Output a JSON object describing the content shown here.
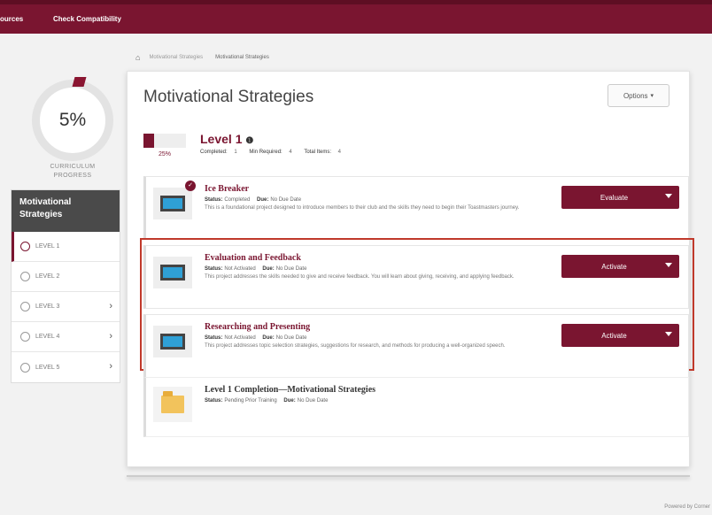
{
  "topbar": {
    "left_cut_link": "ources",
    "check_compat_link": "Check Compatibility"
  },
  "curriculum": {
    "percent": "5%",
    "label_line1": "CURRICULUM",
    "label_line2": "PROGRESS"
  },
  "side_nav": {
    "header": "Motivational Strategies",
    "levels": [
      {
        "label": "LEVEL 1",
        "has_chevron": false
      },
      {
        "label": "LEVEL 2",
        "has_chevron": false
      },
      {
        "label": "LEVEL 3",
        "has_chevron": true
      },
      {
        "label": "LEVEL 4",
        "has_chevron": true
      },
      {
        "label": "LEVEL 5",
        "has_chevron": true
      }
    ],
    "chevron": "›"
  },
  "breadcrumb": {
    "home_icon": "⌂",
    "items": [
      "Motivational Strategies",
      "Motivational Strategies"
    ]
  },
  "page": {
    "title": "Motivational Strategies",
    "options_label": "Options",
    "options_caret": "▾"
  },
  "level": {
    "title": "Level 1",
    "info_icon": "❶",
    "percent": "25%",
    "progress_fraction": 0.25,
    "completed_label": "Completed:",
    "completed_value": "1",
    "min_required_label": "Min Required:",
    "min_required_value": "4",
    "total_items_label": "Total Items:",
    "total_items_value": "4"
  },
  "projects": [
    {
      "title": "Ice Breaker",
      "status_label": "Status:",
      "status": "Completed",
      "due_label": "Due:",
      "due": "No Due Date",
      "desc": "This is a foundational project designed to introduce members to their club and the skills they need to begin their Toastmasters journey.",
      "action": "Evaluate",
      "completed_mark": "✓"
    },
    {
      "title": "Evaluation and Feedback",
      "status_label": "Status:",
      "status": "Not Activated",
      "due_label": "Due:",
      "due": "No Due Date",
      "desc": "This project addresses the skills needed to give and receive feedback. You will learn about giving, receiving, and applying feedback.",
      "action": "Activate"
    },
    {
      "title": "Researching and Presenting",
      "status_label": "Status:",
      "status": "Not Activated",
      "due_label": "Due:",
      "due": "No Due Date",
      "desc": "This project addresses topic selection strategies, suggestions for research, and methods for producing a well-organized speech.",
      "action": "Activate"
    }
  ],
  "completion": {
    "title": "Level 1 Completion—Motivational Strategies",
    "status_label": "Status:",
    "status": "Pending Prior Training",
    "due_label": "Due:",
    "due": "No Due Date"
  },
  "footer": {
    "powered_by": "Powered by Corner"
  },
  "colors": {
    "brand": "#7a1530",
    "highlight": "#c0392b",
    "monitor": "#2fa0d6"
  }
}
